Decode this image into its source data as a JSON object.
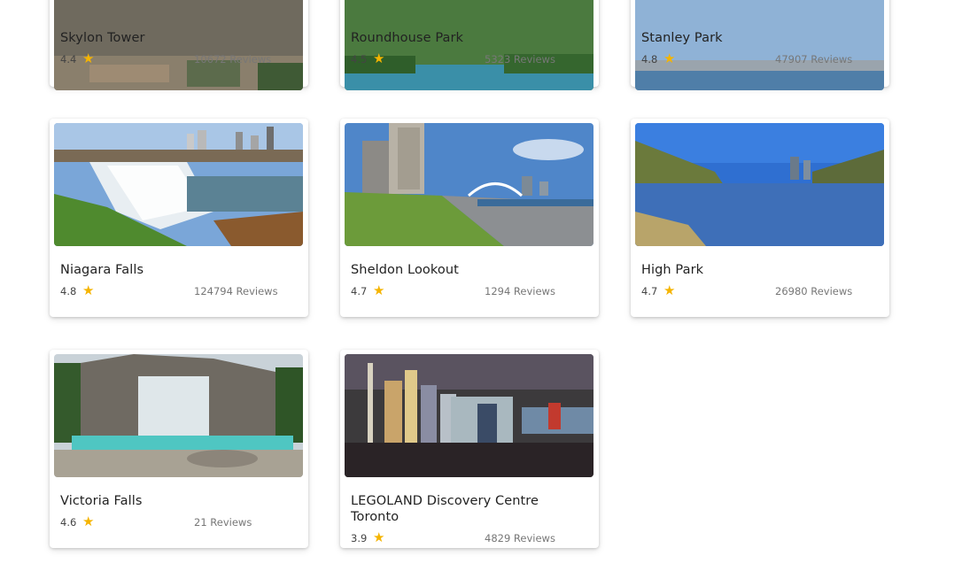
{
  "colors": {
    "star": "#f5b400",
    "title_text": "#222222",
    "reviews_text": "#777777"
  },
  "icons": {
    "star": "★"
  },
  "places": [
    {
      "name": "Skylon Tower",
      "rating": "4.4",
      "reviews": "10672 Reviews"
    },
    {
      "name": "Roundhouse Park",
      "rating": "4.5",
      "reviews": "5323 Reviews"
    },
    {
      "name": "Stanley Park",
      "rating": "4.8",
      "reviews": "47907 Reviews"
    },
    {
      "name": "Niagara Falls",
      "rating": "4.8",
      "reviews": "124794 Reviews"
    },
    {
      "name": "Sheldon Lookout",
      "rating": "4.7",
      "reviews": "1294 Reviews"
    },
    {
      "name": "High Park",
      "rating": "4.7",
      "reviews": "26980 Reviews"
    },
    {
      "name": "Victoria Falls",
      "rating": "4.6",
      "reviews": "21 Reviews"
    },
    {
      "name": "LEGOLAND Discovery Centre Toronto",
      "rating": "3.9",
      "reviews": "4829 Reviews"
    }
  ]
}
